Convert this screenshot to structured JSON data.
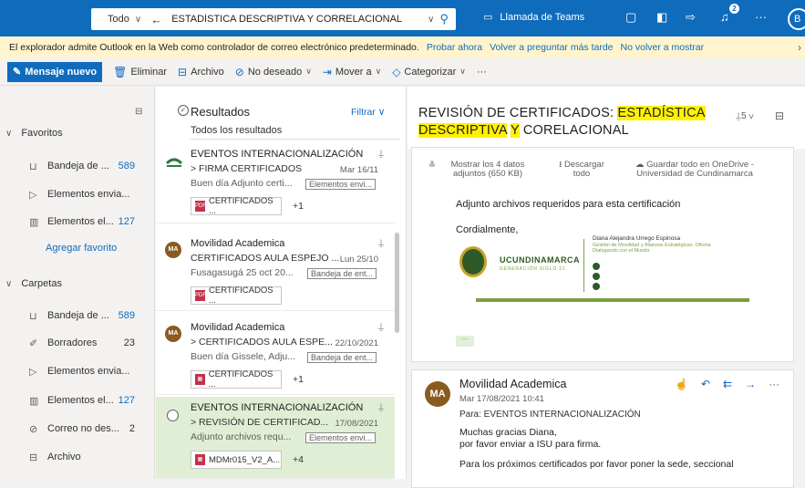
{
  "topbar": {
    "scope": "Todo",
    "query": "ESTADÍSTICA DESCRIPTIVA Y CORRELACIONAL",
    "teams_label": "Llamada de Teams",
    "notification_count": "2",
    "avatar_initial": "B"
  },
  "infobar": {
    "message": "El explorador admite Outlook en la Web como controlador de correo electrónico predeterminado.",
    "try_now": "Probar ahora",
    "ask_later": "Volver a preguntar más tarde",
    "never_show": "No volver a mostrar"
  },
  "commands": {
    "new_message": "Mensaje nuevo",
    "delete": "Eliminar",
    "archive": "Archivo",
    "junk": "No deseado",
    "move_to": "Mover a",
    "categorize": "Categorizar",
    "more": "···"
  },
  "nav": {
    "favorites_header": "Favoritos",
    "favorites": [
      {
        "label": "Bandeja de ...",
        "count": "589"
      },
      {
        "label": "Elementos envia...",
        "count": ""
      },
      {
        "label": "Elementos el...",
        "count": "127"
      }
    ],
    "add_favorite": "Agregar favorito",
    "folders_header": "Carpetas",
    "folders": [
      {
        "label": "Bandeja de ...",
        "count": "589"
      },
      {
        "label": "Borradores",
        "count": "23"
      },
      {
        "label": "Elementos envia...",
        "count": ""
      },
      {
        "label": "Elementos el...",
        "count": "127"
      },
      {
        "label": "Correo no des...",
        "count": "2"
      },
      {
        "label": "Archivo",
        "count": ""
      }
    ]
  },
  "list": {
    "title": "Resultados",
    "filter": "Filtrar",
    "subtitle": "Todos los resultados",
    "items": [
      {
        "sender": "EVENTOS INTERNACIONALIZACIÓN",
        "subject": "> FIRMA CERTIFICADOS",
        "date": "Mar 16/11",
        "preview": "Buen día Adjunto certi...",
        "folder": "Elementos envi...",
        "attachment": "CERTIFICADOS ...",
        "more": "+1"
      },
      {
        "sender": "Movilidad Academica",
        "subject": "CERTIFICADOS AULA ESPEJO ...",
        "date": "Lun 25/10",
        "preview": "Fusagasugá 25 oct 20...",
        "folder": "Bandeja de ent...",
        "attachment": "CERTIFICADOS ...",
        "more": "",
        "avatar": "MA"
      },
      {
        "sender": "Movilidad Academica",
        "subject": "> CERTIFICADOS AULA ESPE...",
        "date": "22/10/2021",
        "preview": "Buen día Gissele, Adju...",
        "folder": "Bandeja de ent...",
        "attachment": "CERTIFICADOS ...",
        "more": "+1",
        "avatar": "MA"
      },
      {
        "sender": "EVENTOS INTERNACIONALIZACIÓN",
        "subject": "> REVISIÓN DE CERTIFICAD...",
        "date": "17/08/2021",
        "preview": "Adjunto archivos requ...",
        "folder": "Elementos envi...",
        "attachment": "MDMr015_V2_A...",
        "more": "+4"
      }
    ]
  },
  "reader": {
    "title_1": "REVISIÓN DE CERTIFICADOS: ",
    "title_hl1": "ESTADÍSTICA",
    "title_hl2": "DESCRIPTIVA",
    "title_2": " ",
    "title_hl3": "Y",
    "title_3": " CORELACIONAL",
    "thread_count": "5",
    "show_attachments": "Mostrar los 4 datos adjuntos (650 KB)",
    "download_all": "Descargar todo",
    "save_onedrive": "Guardar todo en OneDrive - Universidad de Cundinamarca",
    "body_1": "Adjunto archivos requeridos para esta certificación",
    "body_2": "Cordialmente,",
    "sig_org": "UCUNDINAMARCA",
    "sig_org_sub": "GENERACIÓN SIGLO 21",
    "sig_name": "Diana Alejandra Urrego Espinosa",
    "sig_role": "Gestión de Movilidad y Alianzas Estratégicas. Oficina Dialogando con el Mundo",
    "msg2": {
      "avatar": "MA",
      "sender": "Movilidad Academica",
      "date": "Mar 17/08/2021 10:41",
      "to": "Para:  EVENTOS INTERNACIONALIZACIÓN",
      "line1": "Muchas gracias Diana,",
      "line2": "por favor enviar a ISU para firma.",
      "line3": "Para los próximos certificados por favor poner la sede, seccional"
    }
  }
}
